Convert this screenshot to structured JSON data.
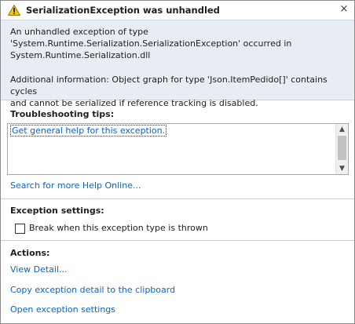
{
  "dialog": {
    "title": "SerializationException was unhandled",
    "close_glyph": "×",
    "warning_icon": "warning-icon",
    "message_line1": "An unhandled exception of type",
    "message_line2": "'System.Runtime.Serialization.SerializationException' occurred in",
    "message_line3": "System.Runtime.Serialization.dll",
    "additional_line1": "Additional information: Object graph for type 'Json.ItemPedido[]' contains cycles",
    "additional_line2": "and cannot be serialized if reference tracking is disabled."
  },
  "troubleshooting": {
    "title": "Troubleshooting tips:",
    "tip_link": "Get general help for this exception.",
    "search_link": "Search for more Help Online..."
  },
  "exception_settings": {
    "title": "Exception settings:",
    "checkbox_label": "Break when this exception type is thrown",
    "checked": false
  },
  "actions": {
    "title": "Actions:",
    "items": [
      "View Detail...",
      "Copy exception detail to the clipboard",
      "Open exception settings"
    ]
  },
  "colors": {
    "link": "#0e63c4",
    "message_background": "#e8ecf3",
    "warning_yellow": "#f5c400"
  }
}
